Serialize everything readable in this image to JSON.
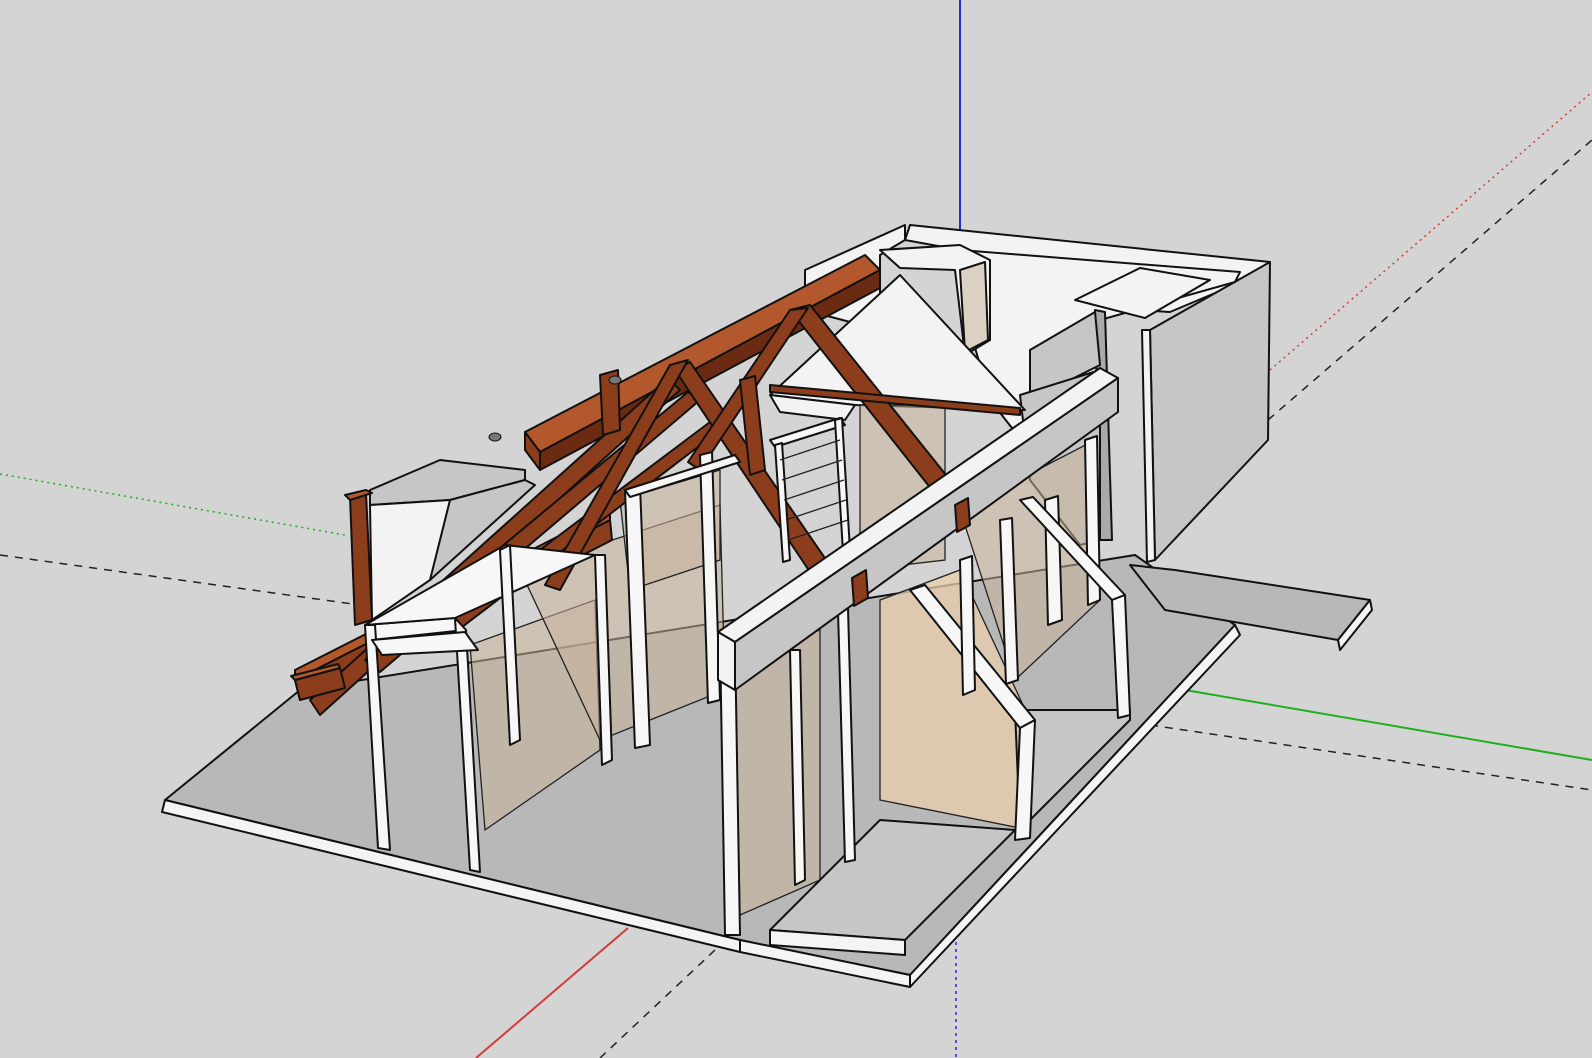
{
  "app": {
    "kind": "3d-modeling-viewport"
  },
  "colors": {
    "background": "#d4d4d4",
    "axis_red": "#d43b3b",
    "axis_green": "#1fae1f",
    "axis_blue": "#2a2ad0",
    "axis_inferred_dash": "#222222",
    "timber": "#8b3d1c",
    "timber_highlight": "#b3582c",
    "glass": "#c8b39a",
    "floor": "#b8b8b8",
    "wall": "#f3f3f3"
  },
  "scene": {
    "model_name": "",
    "axes": [
      "red-axis",
      "green-axis",
      "blue-axis"
    ],
    "components": [
      "floor-slab",
      "roof-trusses",
      "ridge-beam",
      "stud-walls",
      "glass-panels",
      "end-room-walls",
      "front-lintel-beam",
      "side-deck"
    ]
  }
}
